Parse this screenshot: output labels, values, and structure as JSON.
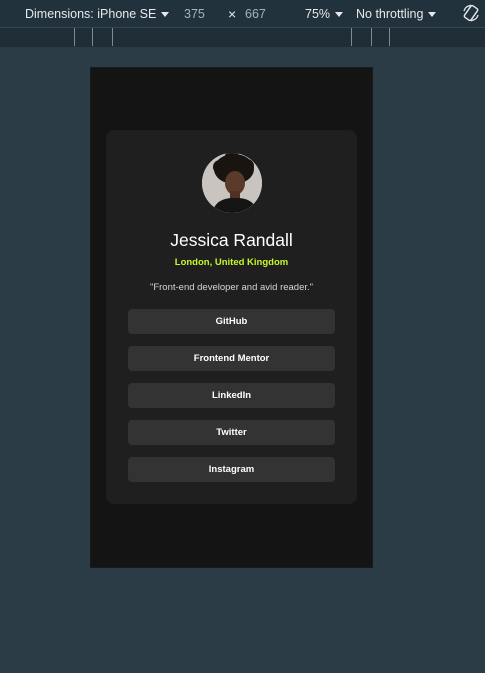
{
  "toolbar": {
    "dimensions_label": "Dimensions: iPhone SE",
    "width": "375",
    "times": "×",
    "height": "667",
    "zoom": "75%",
    "throttling": "No throttling",
    "rotate_icon": "rotate-icon"
  },
  "profile": {
    "name": "Jessica Randall",
    "location": "London, United Kingdom",
    "bio": "\"Front-end developer and avid reader.\"",
    "avatar_icon": "avatar-photo",
    "links": [
      {
        "label": "GitHub"
      },
      {
        "label": "Frontend Mentor"
      },
      {
        "label": "LinkedIn"
      },
      {
        "label": "Twitter"
      },
      {
        "label": "Instagram"
      }
    ]
  },
  "colors": {
    "page_bg": "#2b3c47",
    "viewport_bg": "#141414",
    "card_bg": "#1f1f1f",
    "button_bg": "#333333",
    "accent": "#c4f82a"
  }
}
